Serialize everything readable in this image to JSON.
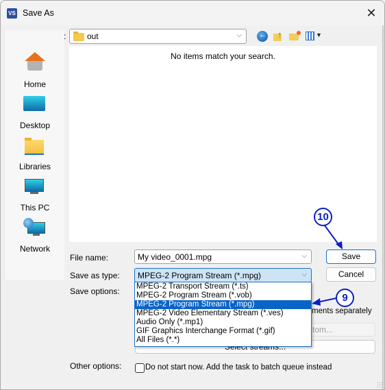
{
  "window": {
    "title": "Save As",
    "app_icon_text": "VS",
    "close_glyph": "✕"
  },
  "save_in": {
    "label": "Save in:",
    "value": "out"
  },
  "toolbar": {
    "icons": [
      "back-icon",
      "up-folder-icon",
      "new-folder-icon",
      "view-menu-icon"
    ]
  },
  "sidebar": {
    "items": [
      {
        "label": "Home",
        "icon": "home-icon"
      },
      {
        "label": "Desktop",
        "icon": "desktop-icon"
      },
      {
        "label": "Libraries",
        "icon": "libraries-icon"
      },
      {
        "label": "This PC",
        "icon": "this-pc-icon"
      },
      {
        "label": "Network",
        "icon": "network-icon"
      }
    ]
  },
  "file_list": {
    "empty_message": "No items match your search."
  },
  "form": {
    "file_name_label": "File name:",
    "file_name_value": "My video_0001.mpg",
    "save_type_label": "Save as type:",
    "save_type_value": "MPEG-2 Program Stream (*.mpg)",
    "save_options_label": "Save options:",
    "other_options_label": "Other options:",
    "segments_text": "ments separately",
    "custom_button_partial": "tom...",
    "select_streams_button": "Select streams...",
    "batch_checkbox_label": "Do not start now. Add the task to batch queue instead",
    "batch_checkbox_checked": false
  },
  "dropdown": {
    "options": [
      {
        "label": "MPEG-2 Transport Stream (*.ts)",
        "selected": false
      },
      {
        "label": "MPEG-2 Program Stream (*.vob)",
        "selected": false
      },
      {
        "label": "MPEG-2 Program Stream (*.mpg)",
        "selected": true
      },
      {
        "label": "MPEG-2 Video Elementary Stream (*.ves)",
        "selected": false
      },
      {
        "label": "Audio Only (*.mp1)",
        "selected": false
      },
      {
        "label": "GIF Graphics Interchange Format (*.gif)",
        "selected": false
      },
      {
        "label": "All Files (*.*)",
        "selected": false
      }
    ]
  },
  "buttons": {
    "save": "Save",
    "cancel": "Cancel"
  },
  "annotations": {
    "step_save": "10",
    "step_type": "9",
    "color": "#0a1fc8"
  }
}
